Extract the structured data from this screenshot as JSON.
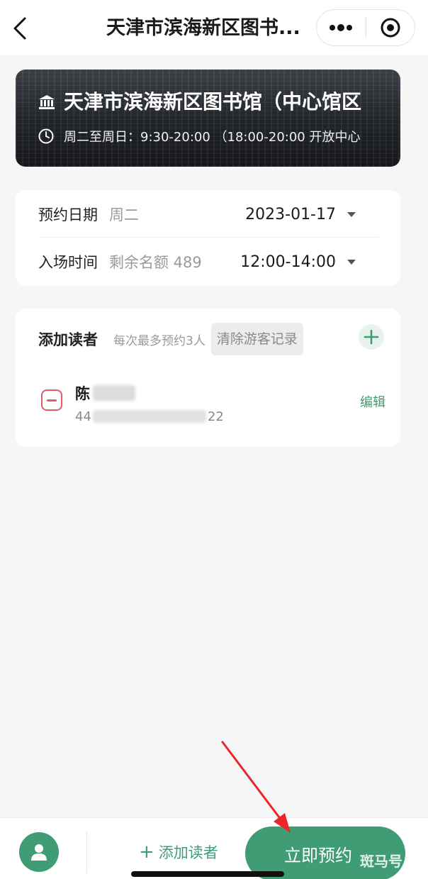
{
  "navbar": {
    "title": "天津市滨海新区图书..."
  },
  "banner": {
    "library_name": "天津市滨海新区图书馆（中心馆区",
    "hours": "周二至周日：9:30-20:00 （18:00-20:00 开放中心"
  },
  "reservation": {
    "date_label": "预约日期",
    "weekday": "周二",
    "date_value": "2023-01-17",
    "time_label": "入场时间",
    "remaining": "剩余名额 489",
    "time_value": "12:00-14:00"
  },
  "readers": {
    "title": "添加读者",
    "limit_note": "每次最多预约3人",
    "clear_label": "清除游客记录",
    "items": [
      {
        "name": "陈",
        "id_prefix": "44",
        "id_suffix": "22",
        "edit_label": "编辑"
      }
    ]
  },
  "bottom": {
    "add_reader_label": "添加读者",
    "book_label": "立即预约",
    "watermark": "斑马号"
  },
  "colors": {
    "accent": "#3f9c74",
    "danger": "#e05a6a",
    "arrow": "#e8262b"
  }
}
